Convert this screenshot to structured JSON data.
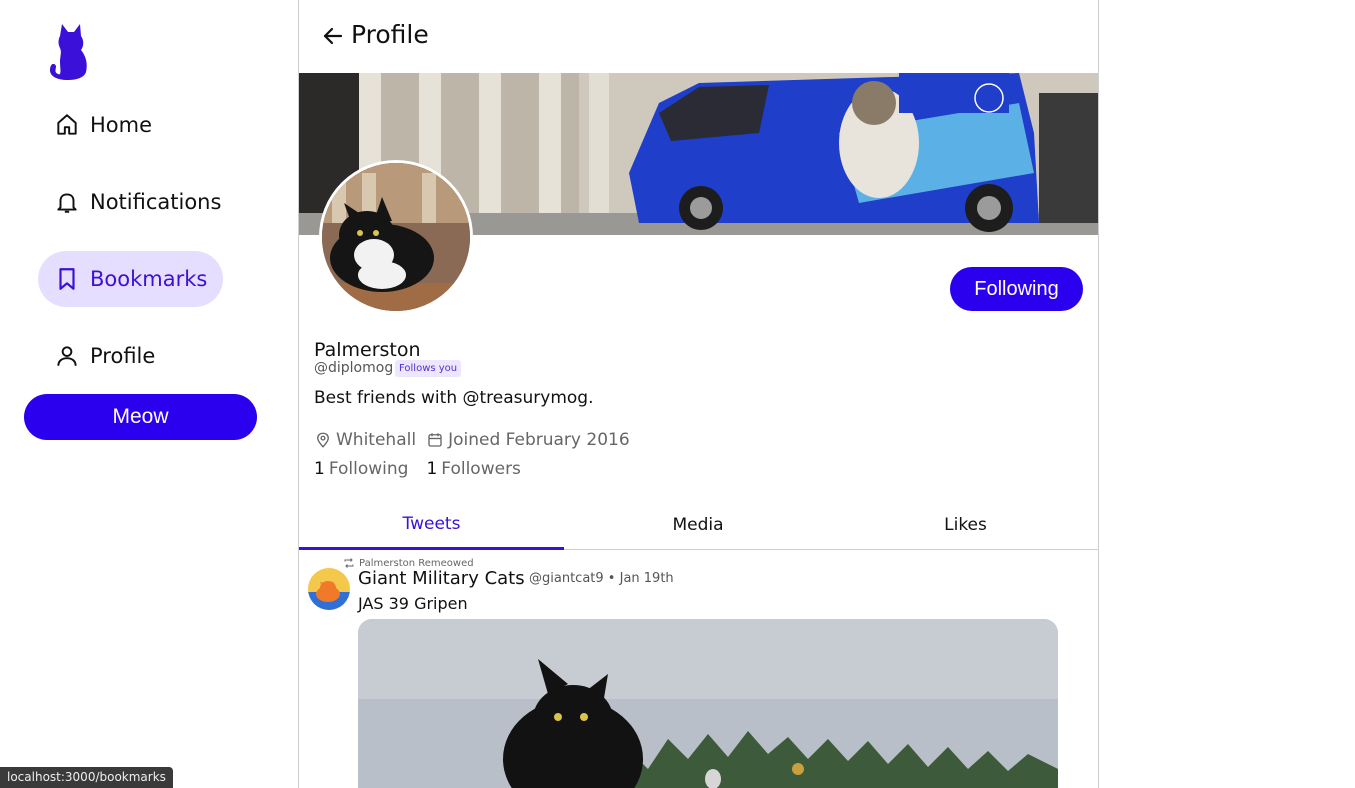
{
  "sidebar": {
    "logo": "cat-logo",
    "items": [
      {
        "label": "Home",
        "icon": "home-icon"
      },
      {
        "label": "Notifications",
        "icon": "bell-icon"
      },
      {
        "label": "Bookmarks",
        "icon": "bookmark-icon",
        "active": true
      },
      {
        "label": "Profile",
        "icon": "user-icon"
      }
    ],
    "meow_button": "Meow"
  },
  "status_bar": {
    "url": "localhost:3000/bookmarks"
  },
  "header": {
    "title": "Profile"
  },
  "profile": {
    "display_name": "Palmerston",
    "handle": "@diplomog",
    "follows_you": "Follows you",
    "bio": "Best friends with @treasurymog.",
    "location": "Whitehall",
    "joined": "Joined February 2016",
    "following_count": "1",
    "following_label": "Following",
    "followers_count": "1",
    "followers_label": "Followers",
    "follow_button": "Following"
  },
  "tabs": [
    {
      "label": "Tweets",
      "active": true
    },
    {
      "label": "Media"
    },
    {
      "label": "Likes"
    }
  ],
  "tweet": {
    "remeow_text": "Palmerston Remeowed",
    "author": "Giant Military Cats",
    "handle": "@giantcat9",
    "date": "Jan 19th",
    "text": "JAS 39 Gripen"
  },
  "colors": {
    "accent": "#2a00ee",
    "accent_text": "#3b10d8",
    "active_bg": "#e6deff"
  }
}
